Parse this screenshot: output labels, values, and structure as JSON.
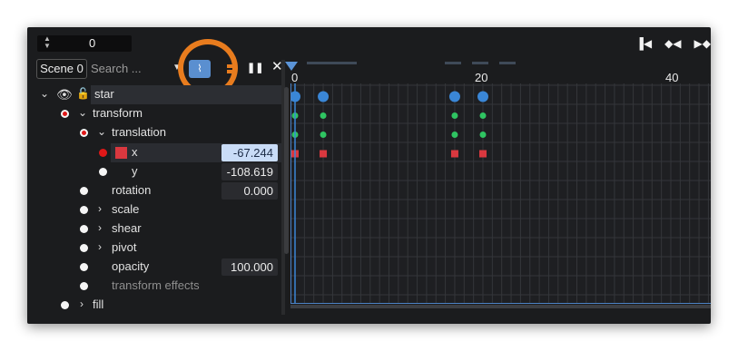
{
  "frame": {
    "value": "0"
  },
  "toolbar": {
    "scene_label": "Scene 0",
    "search_placeholder": "Search ...",
    "filter_icon": "filter-icon",
    "curve_icon": "curve-editor-icon",
    "pause_icon": "pause-icon",
    "close_icon": "close-icon"
  },
  "transport": {
    "items": [
      {
        "icon": "skip-to-start-icon",
        "glyph": "▐◀"
      },
      {
        "icon": "prev-keyframe-icon",
        "glyph": "◆◀"
      },
      {
        "icon": "next-keyframe-icon",
        "glyph": "▶◆"
      }
    ]
  },
  "tree": {
    "star": {
      "label": "star"
    },
    "transform": {
      "label": "transform"
    },
    "translation": {
      "label": "translation"
    },
    "x": {
      "label": "x",
      "value": "-67.244"
    },
    "y": {
      "label": "y",
      "value": "-108.619"
    },
    "rotation": {
      "label": "rotation",
      "value": "0.000"
    },
    "scale": {
      "label": "scale"
    },
    "shear": {
      "label": "shear"
    },
    "pivot": {
      "label": "pivot"
    },
    "opacity": {
      "label": "opacity",
      "value": "100.000"
    },
    "transform_effects": {
      "label": "transform effects"
    },
    "fill": {
      "label": "fill"
    }
  },
  "timeline": {
    "ruler_labels": [
      "0",
      "20",
      "40"
    ],
    "keyframe_frames": [
      0,
      3,
      17,
      20
    ],
    "playhead_frame": 0,
    "colors": {
      "star": "#3a86d6",
      "transform": "#2fc462",
      "x": "#d9383f",
      "accent": "#e87c1e"
    }
  }
}
